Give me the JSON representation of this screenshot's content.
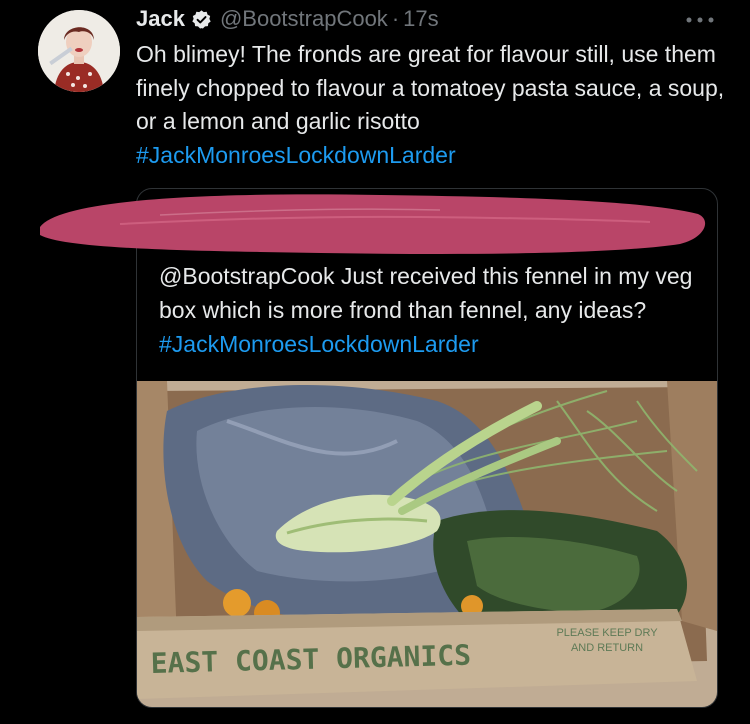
{
  "tweet": {
    "author_name": "Jack",
    "verified_icon": "verified-badge-icon",
    "handle": "@BootstrapCook",
    "separator": "·",
    "time": "17s",
    "text_before": "Oh blimey! The fronds are great for flavour still, use them finely chopped to flavour a tomatoey pasta sauce, a soup, or a lemon and garlic risotto ",
    "hashtag": "#JackMonroesLockdownLarder"
  },
  "quote": {
    "text_before": "@BootstrapCook Just received this fennel in my veg box which is more frond than fennel, any ideas? ",
    "hashtag": "#JackMonroesLockdownLarder",
    "image": {
      "box_brand": "EAST COAST ORGANICS",
      "box_note_line1": "PLEASE KEEP DRY",
      "box_note_line2": "AND RETURN"
    }
  },
  "colors": {
    "background": "#000000",
    "text": "#e7e9ea",
    "muted": "#71767b",
    "link": "#1d9bf0",
    "scribble": "#b94568"
  }
}
